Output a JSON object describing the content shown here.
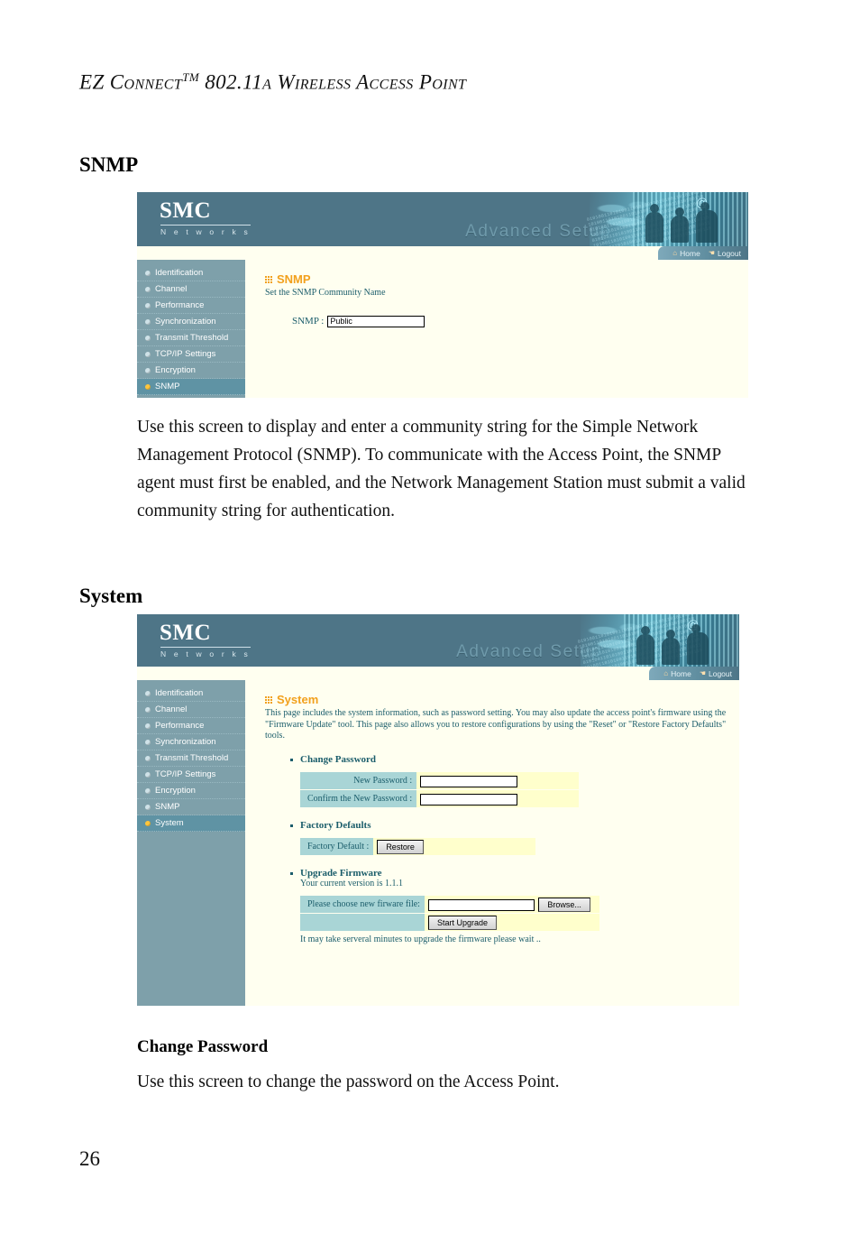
{
  "running_head": {
    "prefix": "EZ C",
    "text": "EZ Connect™ 802.11a Wireless Access Point",
    "part1": "EZ Connect",
    "tm": "TM",
    "part2": " 802.11a Wireless Access Point"
  },
  "page_number": "26",
  "sections": {
    "snmp_heading": "SNMP",
    "snmp_paragraph": "Use this screen to display and enter a community string for the Simple Network Management Protocol (SNMP). To communicate with the Access Point, the SNMP agent must first be enabled, and the Network Management Station must submit a valid community string for authentication.",
    "system_heading": "System",
    "change_password_heading": "Change Password",
    "change_password_paragraph": "Use this screen to change the password on the Access Point."
  },
  "colors": {
    "banner_bg": "#4e7587",
    "sidebar_bg": "#7ea0aa",
    "sidebar_active_bg": "#5f93a4",
    "content_bg": "#fffff0",
    "heading_orange": "#f2a01c",
    "label_teal": "#a9d5d6",
    "field_yellow": "#ffffcc",
    "text_teal": "#1b5d6b",
    "active_bullet": "#ffc63c"
  },
  "browser_ui": {
    "logo_primary": "SMC",
    "logo_secondary": "N e t w o r k s",
    "banner_title": "Advanced Setup",
    "home_label": "Home",
    "logout_label": "Logout",
    "home_icon": "home-icon",
    "logout_icon": "logout-running-person-icon",
    "nav_items": [
      "Identification",
      "Channel",
      "Performance",
      "Synchronization",
      "Transmit Threshold",
      "TCP/IP Settings",
      "Encryption",
      "SNMP",
      "System"
    ]
  },
  "snmp_screen": {
    "page_title": "SNMP",
    "page_desc": "Set the SNMP Community Name",
    "field_label": "SNMP :",
    "field_value": "Public",
    "active_nav": "SNMP"
  },
  "system_screen": {
    "page_title": "System",
    "page_desc": "This page includes the system information, such as password setting. You may also update the access point's firmware using the \"Firmware Update\" tool. This page also allows you to restore configurations by using the \"Reset\" or \"Restore Factory Defaults\" tools.",
    "active_nav": "System",
    "change_password": {
      "heading": "Change Password",
      "new_password_label": "New Password :",
      "new_password_value": "",
      "confirm_password_label": "Confirm the New Password :",
      "confirm_password_value": ""
    },
    "factory_defaults": {
      "heading": "Factory Defaults",
      "label": "Factory Default :",
      "button": "Restore"
    },
    "upgrade_firmware": {
      "heading": "Upgrade Firmware",
      "version_text": "Your current version is 1.1.1",
      "file_label": "Please choose new firware file:",
      "file_value": "",
      "browse_button": "Browse...",
      "start_button": "Start Upgrade",
      "note": "It may take serveral minutes to upgrade the firmware please wait .."
    }
  }
}
